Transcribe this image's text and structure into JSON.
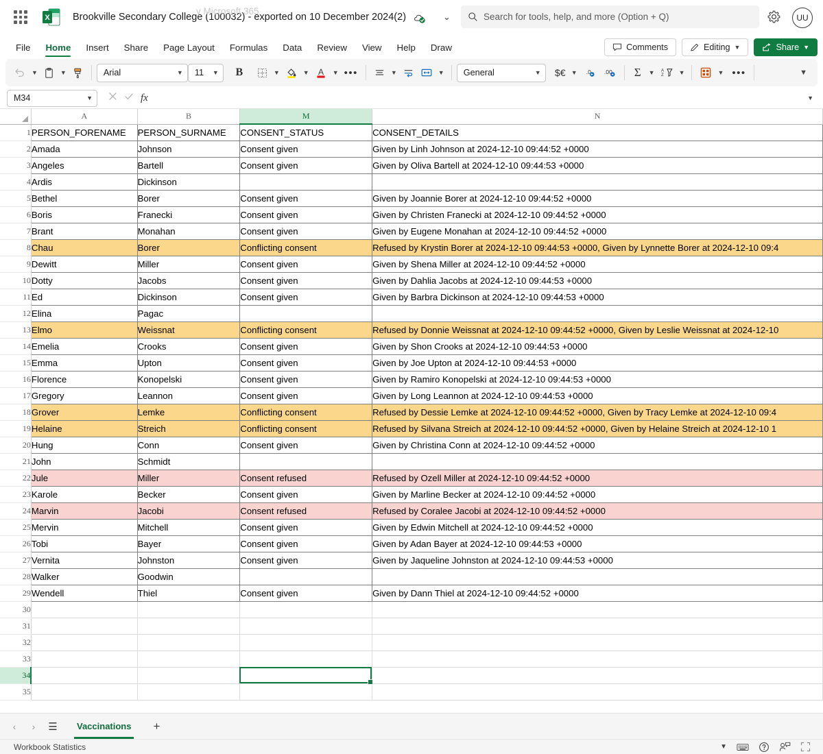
{
  "titlebar": {
    "app_launcher": "waffle-icon",
    "document_title": "Brookville Secondary College (100032) - exported on 10 December 2024(2)",
    "cloud_status_icon": "cloud-saved-icon",
    "title_chevron": "⌄",
    "search_placeholder": "Search for tools, help, and more (Option + Q)",
    "search_ghost_text": "y Microsoft 365",
    "settings_icon": "gear-icon",
    "account_initials": "UU"
  },
  "ribbon": {
    "tabs": [
      {
        "label": "File",
        "active": false
      },
      {
        "label": "Home",
        "active": true
      },
      {
        "label": "Insert",
        "active": false
      },
      {
        "label": "Share",
        "active": false
      },
      {
        "label": "Page Layout",
        "active": false
      },
      {
        "label": "Formulas",
        "active": false
      },
      {
        "label": "Data",
        "active": false
      },
      {
        "label": "Review",
        "active": false
      },
      {
        "label": "View",
        "active": false
      },
      {
        "label": "Help",
        "active": false
      },
      {
        "label": "Draw",
        "active": false
      }
    ],
    "comments_label": "Comments",
    "editing_label": "Editing",
    "share_label": "Share"
  },
  "toolbar": {
    "undo_icon": "undo-icon",
    "paste_icon": "clipboard-icon",
    "format_painter_icon": "format-painter-icon",
    "font_name": "Arial",
    "font_size": "11",
    "bold_label": "B",
    "borders_icon": "borders-icon",
    "fill_color_icon": "fill-color-icon",
    "font_color_icon": "font-color-icon",
    "more_font_icon": "ellipsis-icon",
    "align_icon": "align-icon",
    "wrap_text_icon": "wrap-text-icon",
    "merge_icon": "merge-cells-icon",
    "number_format": "General",
    "currency_icon": "currency-icon",
    "decrease_decimal_icon": "decrease-decimal-icon",
    "increase_decimal_icon": "increase-decimal-icon",
    "autosum_icon": "autosum-icon",
    "sort_filter_icon": "sort-filter-icon",
    "cell_styles_icon": "cell-styles-icon",
    "more_icon": "ellipsis-icon",
    "collapse_ribbon_icon": "chevron-down-icon"
  },
  "formula_bar": {
    "name_box_value": "M34",
    "cancel_icon": "cancel-icon",
    "enter_icon": "check-icon",
    "function_icon": "fx-icon",
    "formula_value": "",
    "expand_icon": "chevron-down-icon"
  },
  "grid": {
    "columns": [
      {
        "letter": "A",
        "selected": false
      },
      {
        "letter": "B",
        "selected": false
      },
      {
        "letter": "M",
        "selected": true
      },
      {
        "letter": "N",
        "selected": false
      }
    ],
    "selected_cell": "M34",
    "first_row": 1,
    "last_row": 35,
    "header_row": {
      "row": 1,
      "A": "PERSON_FORENAME",
      "B": "PERSON_SURNAME",
      "M": "CONSENT_STATUS",
      "N": "CONSENT_DETAILS"
    },
    "rows": [
      {
        "row": 2,
        "A": "Amada",
        "B": "Johnson",
        "M": "Consent given",
        "N": "Given by Linh Johnson at 2024-12-10 09:44:52 +0000",
        "fill": "none"
      },
      {
        "row": 3,
        "A": "Angeles",
        "B": "Bartell",
        "M": "Consent given",
        "N": "Given by Oliva Bartell at 2024-12-10 09:44:53 +0000",
        "fill": "none"
      },
      {
        "row": 4,
        "A": "Ardis",
        "B": "Dickinson",
        "M": "",
        "N": "",
        "fill": "none"
      },
      {
        "row": 5,
        "A": "Bethel",
        "B": "Borer",
        "M": "Consent given",
        "N": "Given by Joannie Borer at 2024-12-10 09:44:52 +0000",
        "fill": "none"
      },
      {
        "row": 6,
        "A": "Boris",
        "B": "Franecki",
        "M": "Consent given",
        "N": "Given by Christen Franecki at 2024-12-10 09:44:52 +0000",
        "fill": "none"
      },
      {
        "row": 7,
        "A": "Brant",
        "B": "Monahan",
        "M": "Consent given",
        "N": "Given by Eugene Monahan at 2024-12-10 09:44:52 +0000",
        "fill": "none"
      },
      {
        "row": 8,
        "A": "Chau",
        "B": "Borer",
        "M": "Conflicting consent",
        "N": "Refused by Krystin Borer at 2024-12-10 09:44:53 +0000, Given by Lynnette Borer at 2024-12-10 09:4",
        "fill": "orange"
      },
      {
        "row": 9,
        "A": "Dewitt",
        "B": "Miller",
        "M": "Consent given",
        "N": "Given by Shena Miller at 2024-12-10 09:44:52 +0000",
        "fill": "none"
      },
      {
        "row": 10,
        "A": "Dotty",
        "B": "Jacobs",
        "M": "Consent given",
        "N": "Given by Dahlia Jacobs at 2024-12-10 09:44:53 +0000",
        "fill": "none"
      },
      {
        "row": 11,
        "A": "Ed",
        "B": "Dickinson",
        "M": "Consent given",
        "N": "Given by Barbra Dickinson at 2024-12-10 09:44:53 +0000",
        "fill": "none"
      },
      {
        "row": 12,
        "A": "Elina",
        "B": "Pagac",
        "M": "",
        "N": "",
        "fill": "none"
      },
      {
        "row": 13,
        "A": "Elmo",
        "B": "Weissnat",
        "M": "Conflicting consent",
        "N": "Refused by Donnie Weissnat at 2024-12-10 09:44:52 +0000, Given by Leslie Weissnat at 2024-12-10",
        "fill": "orange"
      },
      {
        "row": 14,
        "A": "Emelia",
        "B": "Crooks",
        "M": "Consent given",
        "N": "Given by Shon Crooks at 2024-12-10 09:44:53 +0000",
        "fill": "none"
      },
      {
        "row": 15,
        "A": "Emma",
        "B": "Upton",
        "M": "Consent given",
        "N": "Given by Joe Upton at 2024-12-10 09:44:53 +0000",
        "fill": "none"
      },
      {
        "row": 16,
        "A": "Florence",
        "B": "Konopelski",
        "M": "Consent given",
        "N": "Given by Ramiro Konopelski at 2024-12-10 09:44:53 +0000",
        "fill": "none"
      },
      {
        "row": 17,
        "A": "Gregory",
        "B": "Leannon",
        "M": "Consent given",
        "N": "Given by Long Leannon at 2024-12-10 09:44:53 +0000",
        "fill": "none"
      },
      {
        "row": 18,
        "A": "Grover",
        "B": "Lemke",
        "M": "Conflicting consent",
        "N": "Refused by Dessie Lemke at 2024-12-10 09:44:52 +0000, Given by Tracy Lemke at 2024-12-10 09:4",
        "fill": "orange"
      },
      {
        "row": 19,
        "A": "Helaine",
        "B": "Streich",
        "M": "Conflicting consent",
        "N": "Refused by Silvana Streich at 2024-12-10 09:44:52 +0000, Given by Helaine Streich at 2024-12-10 1",
        "fill": "orange"
      },
      {
        "row": 20,
        "A": "Hung",
        "B": "Conn",
        "M": "Consent given",
        "N": "Given by Christina Conn at 2024-12-10 09:44:52 +0000",
        "fill": "none"
      },
      {
        "row": 21,
        "A": "John",
        "B": "Schmidt",
        "M": "",
        "N": "",
        "fill": "none"
      },
      {
        "row": 22,
        "A": "Jule",
        "B": "Miller",
        "M": "Consent refused",
        "N": "Refused by Ozell Miller at 2024-12-10 09:44:52 +0000",
        "fill": "pink"
      },
      {
        "row": 23,
        "A": "Karole",
        "B": "Becker",
        "M": "Consent given",
        "N": "Given by Marline Becker at 2024-12-10 09:44:52 +0000",
        "fill": "none"
      },
      {
        "row": 24,
        "A": "Marvin",
        "B": "Jacobi",
        "M": "Consent refused",
        "N": "Refused by Coralee Jacobi at 2024-12-10 09:44:52 +0000",
        "fill": "pink"
      },
      {
        "row": 25,
        "A": "Mervin",
        "B": "Mitchell",
        "M": "Consent given",
        "N": "Given by Edwin Mitchell at 2024-12-10 09:44:52 +0000",
        "fill": "none"
      },
      {
        "row": 26,
        "A": "Tobi",
        "B": "Bayer",
        "M": "Consent given",
        "N": "Given by Adan Bayer at 2024-12-10 09:44:53 +0000",
        "fill": "none"
      },
      {
        "row": 27,
        "A": "Vernita",
        "B": "Johnston",
        "M": "Consent given",
        "N": "Given by Jaqueline Johnston at 2024-12-10 09:44:53 +0000",
        "fill": "none"
      },
      {
        "row": 28,
        "A": "Walker",
        "B": "Goodwin",
        "M": "",
        "N": "",
        "fill": "none"
      },
      {
        "row": 29,
        "A": "Wendell",
        "B": "Thiel",
        "M": "Consent given",
        "N": "Given by Dann Thiel at 2024-12-10 09:44:52 +0000",
        "fill": "none"
      },
      {
        "row": 30,
        "A": "",
        "B": "",
        "M": "",
        "N": "",
        "fill": "none"
      },
      {
        "row": 31,
        "A": "",
        "B": "",
        "M": "",
        "N": "",
        "fill": "none"
      },
      {
        "row": 32,
        "A": "",
        "B": "",
        "M": "",
        "N": "",
        "fill": "none"
      },
      {
        "row": 33,
        "A": "",
        "B": "",
        "M": "",
        "N": "",
        "fill": "none"
      },
      {
        "row": 34,
        "A": "",
        "B": "",
        "M": "",
        "N": "",
        "fill": "none"
      },
      {
        "row": 35,
        "A": "",
        "B": "",
        "M": "",
        "N": "",
        "fill": "none"
      }
    ]
  },
  "sheetbar": {
    "prev_icon": "chevron-left-icon",
    "next_icon": "chevron-right-icon",
    "sheet_list_icon": "hamburger-icon",
    "active_sheet": "Vaccinations",
    "add_sheet_icon": "plus-icon"
  },
  "statusbar": {
    "workbook_statistics": "Workbook Statistics",
    "chevron_icon": "chevron-down-icon",
    "keyboard_icon": "keyboard-icon",
    "help_icon": "help-circle-icon",
    "accessibility_icon": "feedback-icon",
    "fullscreen_icon": "fullscreen-icon"
  },
  "colors": {
    "accent_green": "#107c41",
    "conflict_fill": "#fbd78c",
    "refused_fill": "#f8d3d0",
    "selected_header": "#cfebd9"
  }
}
